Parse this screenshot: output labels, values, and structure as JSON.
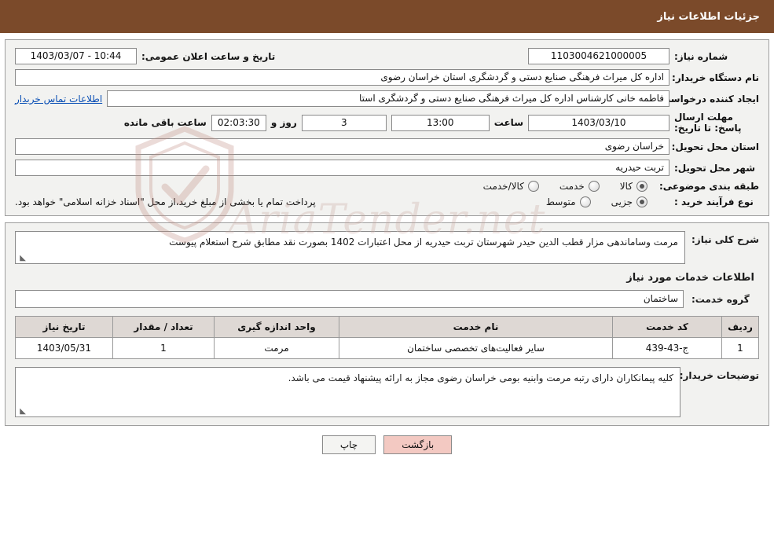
{
  "header": {
    "title": "جزئیات اطلاعات نیاز"
  },
  "top_form": {
    "need_number_label": "شماره نیاز:",
    "need_number_value": "1103004621000005",
    "announce_datetime_label": "تاریخ و ساعت اعلان عمومی:",
    "announce_datetime_value": "1403/03/07 - 10:44",
    "buyer_org_label": "نام دستگاه خریدار:",
    "buyer_org_value": "اداره کل میراث فرهنگی  صنایع دستی و گردشگری استان خراسان رضوی",
    "requester_label": "ایجاد کننده درخواست:",
    "requester_value": "فاطمه خانی کارشناس اداره کل میراث فرهنگی  صنایع دستی و گردشگری استا",
    "contact_link": "اطلاعات تماس خریدار",
    "deadline_label": "مهلت ارسال پاسخ: تا تاریخ:",
    "deadline_date": "1403/03/10",
    "deadline_hour_label": "ساعت",
    "deadline_hour_value": "13:00",
    "remaining_days_value": "3",
    "remaining_days_label": "روز و",
    "remaining_time_value": "02:03:30",
    "remaining_time_label": "ساعت باقی مانده",
    "province_label": "استان محل تحویل:",
    "province_value": "خراسان رضوی",
    "city_label": "شهر محل تحویل:",
    "city_value": "تربت حیدریه",
    "category_label": "طبقه بندی موضوعی:",
    "category_options": [
      {
        "label": "کالا",
        "selected": true
      },
      {
        "label": "خدمت",
        "selected": false
      },
      {
        "label": "کالا/خدمت",
        "selected": false
      }
    ],
    "purchase_type_label": "نوع فرآیند خرید :",
    "purchase_type_options": [
      {
        "label": "جزیی",
        "selected": true
      },
      {
        "label": "متوسط",
        "selected": false
      }
    ],
    "purchase_note": "پرداخت تمام یا بخشی از مبلغ خرید،از محل \"اسناد خزانه اسلامی\" خواهد بود."
  },
  "bottom": {
    "general_desc_label": "شرح کلی نیاز:",
    "general_desc_value": "مرمت وساماندهی مزار قطب الدین حیدر شهرستان تربت حیدریه از محل اعتبارات 1402 بصورت نقد مطابق شرح استعلام پیوست",
    "services_section_title": "اطلاعات خدمات مورد نیاز",
    "service_group_label": "گروه خدمت:",
    "service_group_value": "ساختمان",
    "table": {
      "columns": [
        "ردیف",
        "کد خدمت",
        "نام خدمت",
        "واحد اندازه گیری",
        "تعداد / مقدار",
        "تاریخ نیاز"
      ],
      "rows": [
        {
          "row": "1",
          "code": "ج-43-439",
          "name": "سایر فعالیت‌های تخصصی ساختمان",
          "unit": "مرمت",
          "qty": "1",
          "date": "1403/05/31"
        }
      ]
    },
    "buyer_notes_label": "توضیحات خریدار:",
    "buyer_notes_value": "کلیه پیمانکاران دارای رتبه مرمت وابنیه بومی خراسان رضوی مجاز به ارائه پیشنهاد قیمت می باشد."
  },
  "footer": {
    "print_label": "چاپ",
    "back_label": "بازگشت"
  },
  "watermark": {
    "text": "AriaTender.net"
  },
  "colors": {
    "header_bg": "#7b4a2a",
    "panel_bg": "#f2f2f0",
    "table_header_bg": "#ded8d4",
    "link": "#0a4fb5",
    "back_button_bg": "#f3c9c2"
  }
}
